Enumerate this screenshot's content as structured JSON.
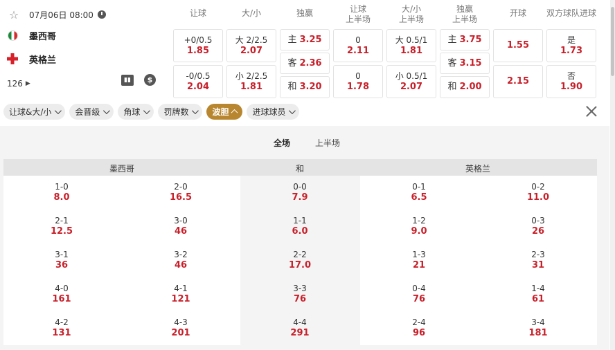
{
  "match": {
    "datetime": "07月06日 08:00",
    "home": "墨西哥",
    "away": "英格兰",
    "markets_count": "126"
  },
  "headers": {
    "handicap": "让球",
    "over_under": "大/小",
    "moneyline": "独赢",
    "ht_handicap": [
      "让球",
      "上半场"
    ],
    "ht_over_under": [
      "大/小",
      "上半场"
    ],
    "ht_moneyline": [
      "独赢",
      "上半场"
    ],
    "kickoff": "开球",
    "btts": "双方球队进球"
  },
  "odds": {
    "handicap": [
      {
        "label": "+0/0.5",
        "val": "1.85"
      },
      {
        "label": "-0/0.5",
        "val": "2.04"
      }
    ],
    "over_under": [
      {
        "label": "大 2/2.5",
        "val": "2.07"
      },
      {
        "label": "小 2/2.5",
        "val": "1.81"
      }
    ],
    "moneyline": [
      {
        "label": "主",
        "val": "3.25"
      },
      {
        "label": "客",
        "val": "2.36"
      },
      {
        "label": "和",
        "val": "3.20"
      }
    ],
    "ht_handicap": [
      {
        "label": "0",
        "val": "2.11"
      },
      {
        "label": "0",
        "val": "1.78"
      }
    ],
    "ht_over_under": [
      {
        "label": "大 0.5/1",
        "val": "1.81"
      },
      {
        "label": "小 0.5/1",
        "val": "2.07"
      }
    ],
    "ht_moneyline": [
      {
        "label": "主",
        "val": "3.75"
      },
      {
        "label": "客",
        "val": "3.15"
      },
      {
        "label": "和",
        "val": "2.00"
      }
    ],
    "kickoff": [
      "1.55",
      "2.15"
    ],
    "btts": [
      {
        "label": "是",
        "val": "1.73"
      },
      {
        "label": "否",
        "val": "1.90"
      }
    ]
  },
  "filters": [
    "让球&大/小",
    "会晋级",
    "角球",
    "罚牌数",
    "波胆",
    "进球球员"
  ],
  "active_filter": "波胆",
  "tabs": [
    "全场",
    "上半场"
  ],
  "active_tab": "全场",
  "score_table": {
    "headers": [
      "墨西哥",
      "和",
      "英格兰"
    ],
    "columns": [
      [
        {
          "s": "1-0",
          "o": "8.0"
        },
        {
          "s": "2-1",
          "o": "12.5"
        },
        {
          "s": "3-1",
          "o": "36"
        },
        {
          "s": "4-0",
          "o": "161"
        },
        {
          "s": "4-2",
          "o": "131"
        }
      ],
      [
        {
          "s": "2-0",
          "o": "16.5"
        },
        {
          "s": "3-0",
          "o": "46"
        },
        {
          "s": "3-2",
          "o": "46"
        },
        {
          "s": "4-1",
          "o": "121"
        },
        {
          "s": "4-3",
          "o": "201"
        }
      ],
      [
        {
          "s": "0-0",
          "o": "7.9"
        },
        {
          "s": "1-1",
          "o": "6.0"
        },
        {
          "s": "2-2",
          "o": "17.0"
        },
        {
          "s": "3-3",
          "o": "76"
        },
        {
          "s": "4-4",
          "o": "291"
        }
      ],
      [
        {
          "s": "0-1",
          "o": "6.5"
        },
        {
          "s": "1-2",
          "o": "9.0"
        },
        {
          "s": "1-3",
          "o": "21"
        },
        {
          "s": "0-4",
          "o": "76"
        },
        {
          "s": "2-4",
          "o": "96"
        }
      ],
      [
        {
          "s": "0-2",
          "o": "11.0"
        },
        {
          "s": "0-3",
          "o": "26"
        },
        {
          "s": "2-3",
          "o": "31"
        },
        {
          "s": "1-4",
          "o": "61"
        },
        {
          "s": "3-4",
          "o": "181"
        }
      ]
    ]
  },
  "colors": {
    "odd": "#c8202a",
    "active_chip": "#b8862f"
  }
}
